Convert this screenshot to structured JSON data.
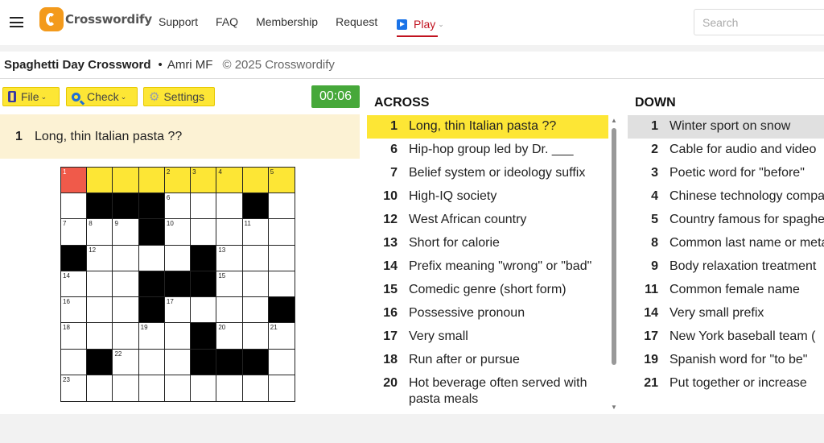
{
  "nav": {
    "brand": "Crosswordify",
    "links": [
      "Support",
      "FAQ",
      "Membership",
      "Request"
    ],
    "play_label": "Play",
    "search_placeholder": "Search"
  },
  "puzzle": {
    "title": "Spaghetti Day Crossword",
    "bullet": "•",
    "author": "Amri MF",
    "copyright": "© 2025 Crosswordify"
  },
  "toolbar": {
    "file_label": "File",
    "check_label": "Check",
    "settings_label": "Settings",
    "timer": "00:06"
  },
  "current_clue": {
    "number": "1",
    "text": "Long, thin Italian pasta ??"
  },
  "grid": {
    "rows": 9,
    "cols": 9,
    "black_cells": [
      [
        1,
        1
      ],
      [
        1,
        2
      ],
      [
        1,
        3
      ],
      [
        1,
        7
      ],
      [
        2,
        3
      ],
      [
        3,
        0
      ],
      [
        3,
        5
      ],
      [
        4,
        3
      ],
      [
        4,
        4
      ],
      [
        4,
        5
      ],
      [
        5,
        3
      ],
      [
        5,
        8
      ],
      [
        6,
        5
      ],
      [
        7,
        1
      ],
      [
        7,
        5
      ],
      [
        7,
        6
      ],
      [
        7,
        7
      ]
    ],
    "highlighted_cells": [
      [
        0,
        1
      ],
      [
        0,
        2
      ],
      [
        0,
        3
      ],
      [
        0,
        4
      ],
      [
        0,
        5
      ],
      [
        0,
        6
      ],
      [
        0,
        7
      ],
      [
        0,
        8
      ]
    ],
    "selected_cell": [
      0,
      0
    ],
    "numbers": [
      {
        "r": 0,
        "c": 0,
        "n": "1"
      },
      {
        "r": 0,
        "c": 4,
        "n": "2"
      },
      {
        "r": 0,
        "c": 5,
        "n": "3"
      },
      {
        "r": 0,
        "c": 6,
        "n": "4"
      },
      {
        "r": 0,
        "c": 8,
        "n": "5"
      },
      {
        "r": 1,
        "c": 4,
        "n": "6"
      },
      {
        "r": 2,
        "c": 0,
        "n": "7"
      },
      {
        "r": 2,
        "c": 1,
        "n": "8"
      },
      {
        "r": 2,
        "c": 2,
        "n": "9"
      },
      {
        "r": 2,
        "c": 4,
        "n": "10"
      },
      {
        "r": 2,
        "c": 7,
        "n": "11"
      },
      {
        "r": 3,
        "c": 1,
        "n": "12"
      },
      {
        "r": 3,
        "c": 6,
        "n": "13"
      },
      {
        "r": 4,
        "c": 0,
        "n": "14"
      },
      {
        "r": 4,
        "c": 6,
        "n": "15"
      },
      {
        "r": 5,
        "c": 0,
        "n": "16"
      },
      {
        "r": 5,
        "c": 4,
        "n": "17"
      },
      {
        "r": 6,
        "c": 0,
        "n": "18"
      },
      {
        "r": 6,
        "c": 3,
        "n": "19"
      },
      {
        "r": 6,
        "c": 6,
        "n": "20"
      },
      {
        "r": 6,
        "c": 8,
        "n": "21"
      },
      {
        "r": 7,
        "c": 2,
        "n": "22"
      },
      {
        "r": 8,
        "c": 0,
        "n": "23"
      }
    ]
  },
  "across": {
    "heading": "ACROSS",
    "clues": [
      {
        "n": "1",
        "t": "Long, thin Italian pasta ??"
      },
      {
        "n": "6",
        "t": "Hip-hop group led by Dr. ___"
      },
      {
        "n": "7",
        "t": "Belief system or ideology suffix"
      },
      {
        "n": "10",
        "t": "High-IQ society"
      },
      {
        "n": "12",
        "t": "West African country"
      },
      {
        "n": "13",
        "t": "Short for calorie"
      },
      {
        "n": "14",
        "t": "Prefix meaning \"wrong\" or \"bad\""
      },
      {
        "n": "15",
        "t": "Comedic genre (short form)"
      },
      {
        "n": "16",
        "t": "Possessive pronoun"
      },
      {
        "n": "17",
        "t": "Very small"
      },
      {
        "n": "18",
        "t": "Run after or pursue"
      },
      {
        "n": "20",
        "t": "Hot beverage often served with pasta meals"
      }
    ]
  },
  "down": {
    "heading": "DOWN",
    "clues": [
      {
        "n": "1",
        "t": "Winter sport on snow"
      },
      {
        "n": "2",
        "t": "Cable for audio and video"
      },
      {
        "n": "3",
        "t": "Poetic word for \"before\""
      },
      {
        "n": "4",
        "t": "Chinese technology company"
      },
      {
        "n": "5",
        "t": "Country famous for spaghetti"
      },
      {
        "n": "8",
        "t": "Common last name or metal worker"
      },
      {
        "n": "9",
        "t": "Body relaxation treatment"
      },
      {
        "n": "11",
        "t": "Common female name"
      },
      {
        "n": "14",
        "t": "Very small prefix"
      },
      {
        "n": "17",
        "t": "New York baseball team ("
      },
      {
        "n": "19",
        "t": "Spanish word for \"to be\""
      },
      {
        "n": "21",
        "t": "Put together or increase"
      }
    ]
  }
}
